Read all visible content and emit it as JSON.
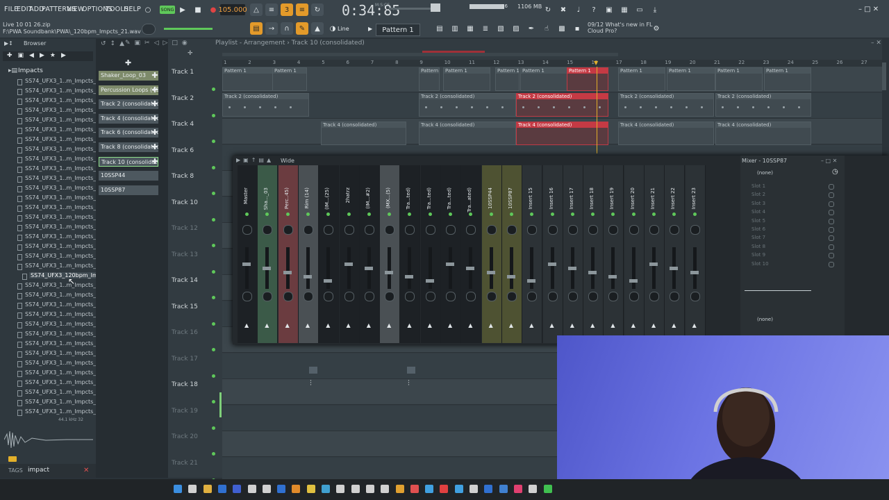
{
  "menu": [
    "FILE",
    "EDIT",
    "ADD",
    "PATTERNS",
    "VIEW",
    "OPTIONS",
    "TOOLS",
    "HELP"
  ],
  "song_label": "SONG",
  "bpm": "105.000",
  "time": "0:34:85",
  "time_unit": "M:S:CS",
  "memory": "1106 MB",
  "cpu": "16",
  "hint": {
    "line1": "Live 10 01 26.zip",
    "line2": "F:\\PWA Soundbank\\PWA\\_120bpm_Impcts_21.wav"
  },
  "pattern_selector": "Pattern 1",
  "snap_mode": "Line",
  "news": {
    "line1": "09/12  What's new in FL",
    "line2": "Cloud Pro?"
  },
  "browser": {
    "title": "Browser",
    "folder": "Impacts",
    "files": [
      "SS74_UFX3_1..m_Impcts_01",
      "SS74_UFX3_1..m_Impcts_02",
      "SS74_UFX3_1..m_Impcts_03",
      "SS74_UFX3_1..m_Impcts_04",
      "SS74_UFX3_1..m_Impcts_05",
      "SS74_UFX3_1..m_Impcts_06",
      "SS74_UFX3_1..m_Impcts_07",
      "SS74_UFX3_1..m_Impcts_08",
      "SS74_UFX3_1..m_Impcts_09",
      "SS74_UFX3_1..m_Impcts_10",
      "SS74_UFX3_1..m_Impcts_11",
      "SS74_UFX3_1..m_Impcts_12",
      "SS74_UFX3_1..m_Impcts_13",
      "SS74_UFX3_1..m_Impcts_14",
      "SS74_UFX3_1..m_Impcts_15",
      "SS74_UFX3_1..m_Impcts_16",
      "SS74_UFX3_1..m_Impcts_17",
      "SS74_UFX3_1..m_Impcts_18",
      "SS74_UFX3_1..m_Impcts_19",
      "SS74_UFX3_1..m_Impcts_20",
      "SS74_UFX3_120bpm_Impcts_21",
      "SS74_UFX3_1..m_Impcts_22",
      "SS74_UFX3_1..m_Impcts_23",
      "SS74_UFX3_1..m_Impcts_24",
      "SS74_UFX3_1..m_Impcts_25",
      "SS74_UFX3_1..m_Impcts_26",
      "SS74_UFX3_1..m_Impcts_27",
      "SS74_UFX3_1..m_Impcts_28",
      "SS74_UFX3_1..m_Impcts_29",
      "SS74_UFX3_1..m_Impcts_30",
      "SS74_UFX3_1..m_Impcts_31",
      "SS74_UFX3_1..m_Impcts_32",
      "SS74_UFX3_1..m_Impcts_33",
      "SS74_UFX3_1..m_Impcts_34",
      "SS74_UFX3_1..m_Impcts_35"
    ],
    "selected_index": 20,
    "sample_info": "44.1 kHz 32",
    "tags_label": "TAGS",
    "tags_value": "impact"
  },
  "channel_rack": [
    "Shaker_Loop_03",
    "Percussion Loops (45)",
    "Track 2 (consolidated)",
    "Track 4 (consolidated)",
    "Track 6 (consolidated)",
    "Track 8 (consolidated)",
    "Track 10 (consolidate..",
    "10SSP44",
    "10SSP87"
  ],
  "playlist": {
    "title": "Playlist - Arrangement › Track 10 (consolidated)",
    "ruler": [
      "1",
      "2",
      "3",
      "4",
      "5",
      "6",
      "7",
      "8",
      "9",
      "10",
      "11",
      "12",
      "13",
      "14",
      "15",
      "16",
      "17",
      "18",
      "19",
      "20",
      "21",
      "22",
      "23",
      "24",
      "25",
      "26",
      "27"
    ],
    "tracks": [
      "Track 1",
      "Track 2",
      "Track 4",
      "Track 6",
      "Track 8",
      "Track 10",
      "Track 12",
      "Track 13",
      "Track 14",
      "Track 15",
      "Track 16",
      "Track 17",
      "Track 18",
      "Track 19",
      "Track 20",
      "Track 21"
    ],
    "pattern_clip": "Pattern 1",
    "clip_t2": "Track 2 (consolidated)",
    "clip_t4": "Track 4 (consolidated)"
  },
  "mixer": {
    "title": "Wide",
    "panel_title": "Mixer - 10SSP87",
    "none": "(none)",
    "slots": [
      "Slot 1",
      "Slot 2",
      "Slot 3",
      "Slot 4",
      "Slot 5",
      "Slot 6",
      "Slot 7",
      "Slot 8",
      "Slot 9",
      "Slot 10"
    ],
    "strips": [
      "Master",
      "Sha..._03",
      "Perc..45)",
      "Rim (14)",
      "(IM...(25)",
      "2hatrz",
      "(IM...#2)",
      "(MX...(5)",
      "Tra...ted)",
      "Tra...ted)",
      "Tra...ted)",
      "Tra...ated)",
      "10SSP44",
      "10SSP87",
      "Insert 15",
      "Insert 16",
      "Insert 17",
      "Insert 18",
      "Insert 19",
      "Insert 20",
      "Insert 21",
      "Insert 22",
      "Insert 23"
    ]
  },
  "colors": {
    "accent_orange": "#e39a2a",
    "clip_red": "#c53a44",
    "led_green": "#5fc85a"
  }
}
